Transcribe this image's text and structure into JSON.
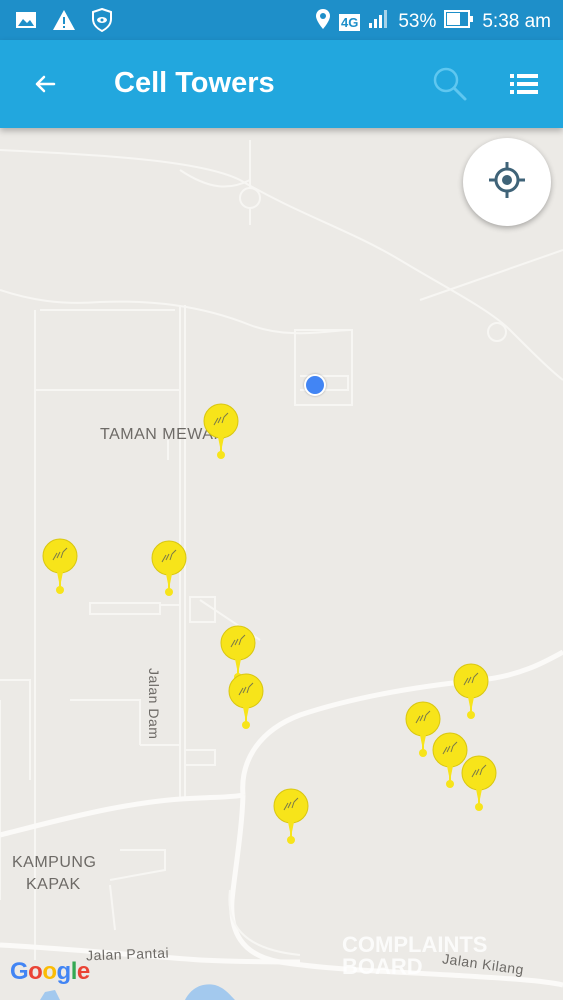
{
  "status_bar": {
    "left_icons": [
      "image-icon",
      "warning-icon",
      "shield-eye-icon"
    ],
    "network": "4G",
    "battery": "53%",
    "time": "5:38 am"
  },
  "app_bar": {
    "title": "Cell Towers",
    "back_icon": "arrow-left-icon",
    "search_icon": "search-icon",
    "list_icon": "list-icon"
  },
  "map": {
    "labels": {
      "taman": "TAMAN MEWAH",
      "jalan_dam": "Jalan Dam",
      "kampung_1": "KAMPUNG",
      "kampung_2": "KAPAK",
      "jalan_pantai": "Jalan Pantai",
      "jalan_kilang": "Jalan Kilang"
    },
    "tower_count": 11,
    "watermark_1": "COMPLAINTS",
    "watermark_2": "BOARD",
    "google_letters": [
      "G",
      "o",
      "o",
      "g",
      "l",
      "e"
    ],
    "colors": {
      "tower": "#f7e41a",
      "user_location": "#4285f4",
      "app_bar": "#22a7de",
      "status_bar": "#1e8fc9"
    }
  },
  "my_location_button": "crosshair-icon"
}
